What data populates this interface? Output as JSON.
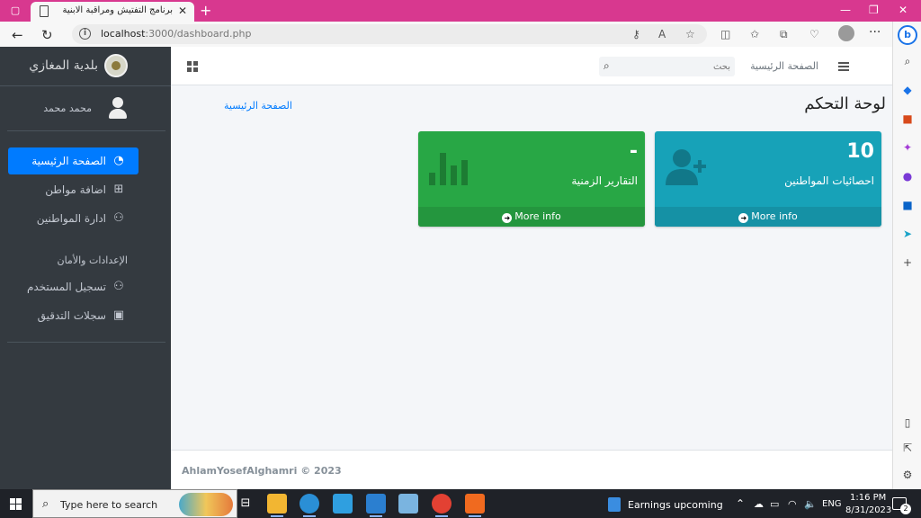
{
  "browser": {
    "tab_title": "برنامج التفتيش ومراقبة الابنية",
    "url_host": "localhost",
    "url_rest": ":3000/dashboard.php",
    "bing_label": "b"
  },
  "sidebar": {
    "brand_name": "بلدية المغازي",
    "user_name": "محمد محمد",
    "items": [
      {
        "label": "الصفحة الرئيسية",
        "icon": "dashboard-icon",
        "active": true
      },
      {
        "label": "اضافة مواطن",
        "icon": "plus-square-icon"
      },
      {
        "label": "ادارة المواطنين",
        "icon": "user-icon"
      }
    ],
    "section_header": "الإعدادات والأمان",
    "settings_items": [
      {
        "label": "تسجيل المستخدم",
        "icon": "user-icon"
      },
      {
        "label": "سجلات التدقيق",
        "icon": "image-icon"
      }
    ]
  },
  "topnav": {
    "search_placeholder": "بحث",
    "home_link": "الصفحة الرئيسية"
  },
  "content": {
    "page_title": "لوحة التحكم",
    "breadcrumb": "الصفحة الرئيسية",
    "boxes": [
      {
        "value": "10",
        "caption": "احصائيات المواطنين",
        "footer": "More info",
        "color": "#17a2b8",
        "icon": "user-plus-icon"
      },
      {
        "value": "-",
        "caption": "التقارير الزمنية",
        "footer": "More info",
        "color": "#28a745",
        "icon": "bar-chart-icon"
      }
    ]
  },
  "footer": {
    "copyright": "AhlamYosefAlghamri © 2023"
  },
  "taskbar": {
    "search_placeholder": "Type here to search",
    "news": "Earnings upcoming",
    "lang": "ENG",
    "time": "1:16 PM",
    "date": "8/31/2023",
    "notifications": "2"
  }
}
